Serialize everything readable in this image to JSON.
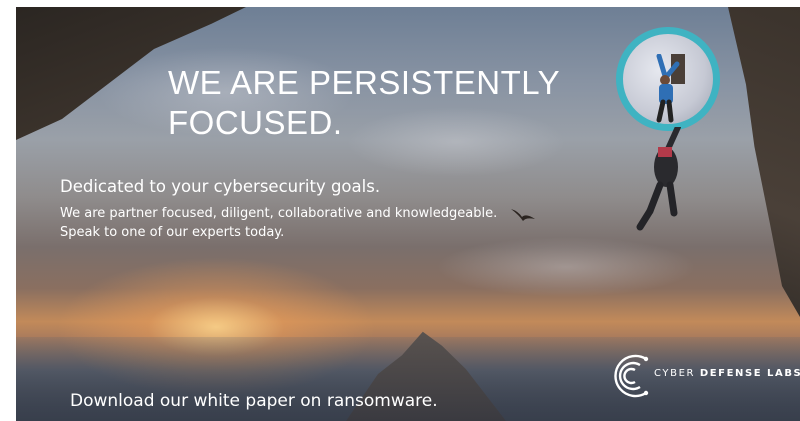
{
  "banner": {
    "headline": "WE ARE PERSISTENTLY FOCUSED.",
    "subheading": "Dedicated to your cybersecurity goals.",
    "body": "We are partner focused, diligent, collaborative and knowledgeable. Speak to one of our experts today.",
    "cta": "Download our white paper on ransomware.",
    "logo": {
      "word1": "CYBER",
      "word2": "DEFENSE",
      "word3": "LABS",
      "icon": "cyber-defense-labs-logo-icon"
    },
    "colors": {
      "accent_ring": "#3fb3c2",
      "text": "#ffffff"
    },
    "icons": [
      "climber-photo",
      "bird-icon",
      "cyber-defense-labs-logo-icon"
    ]
  }
}
